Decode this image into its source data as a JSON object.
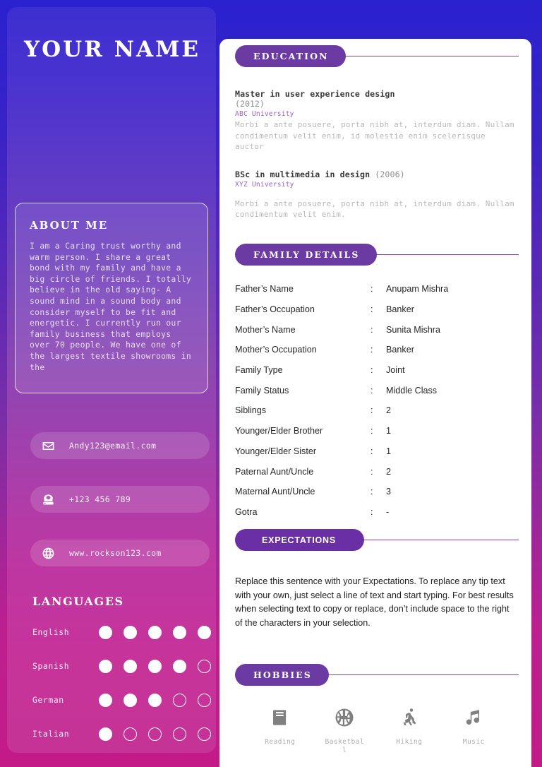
{
  "sidebar": {
    "name": "YOUR  NAME",
    "about": {
      "title": "ABOUT ME",
      "text": "I am a Caring trust worthy and warm person. I share a great bond with my family and have a big circle of friends. I totally believe in the old saying- A sound mind in a sound body and consider myself to be fit and energetic. I currently run our family business that employs over 70 people. We have one of the largest textile showrooms in the"
    },
    "contacts": [
      {
        "icon": "envelope-icon",
        "text": "Andy123@email.com"
      },
      {
        "icon": "telephone-icon",
        "text": "+123 456 789"
      },
      {
        "icon": "globe-icon",
        "text": "www.rockson123.com"
      }
    ],
    "languages": {
      "title": "LANGUAGES",
      "max": 5,
      "items": [
        {
          "name": "English",
          "level": 5
        },
        {
          "name": "Spanish",
          "level": 4
        },
        {
          "name": "German",
          "level": 3
        },
        {
          "name": "Italian",
          "level": 1
        }
      ]
    }
  },
  "main": {
    "education": {
      "title": "EDUCATION",
      "entries": [
        {
          "degree": "Master in user experience design",
          "year": "(2012)",
          "year_inline": false,
          "school": "ABC University",
          "description": "Morbi a ante posuere, porta nibh at, interdum diam. Nullam condimentum velit enim, id molestie enim scelerisque auctor"
        },
        {
          "degree": "BSc in multimedia in design",
          "year": "(2006)",
          "year_inline": true,
          "school": "XYZ University",
          "description": "Morbi a ante posuere, porta nibh at, interdum diam. Nullam condimentum velit enim."
        }
      ]
    },
    "family": {
      "title": "FAMILY DETAILS",
      "separator": ":",
      "rows": [
        {
          "label": "Father’s Name",
          "value": "Anupam Mishra"
        },
        {
          "label": "Father’s Occupation",
          "value": "Banker"
        },
        {
          "label": "Mother’s Name",
          "value": "Sunita Mishra"
        },
        {
          "label": "Mother’s Occupation",
          "value": "Banker"
        },
        {
          "label": "Family Type",
          "value": "Joint"
        },
        {
          "label": "Family Status",
          "value": "Middle Class"
        },
        {
          "label": "Siblings",
          "value": "2"
        },
        {
          "label": "Younger/Elder Brother",
          "value": "1"
        },
        {
          "label": "Younger/Elder Sister",
          "value": "1"
        },
        {
          "label": "Paternal Aunt/Uncle",
          "value": "2"
        },
        {
          "label": "Maternal Aunt/Uncle",
          "value": "3"
        },
        {
          "label": "Gotra",
          "value": "-"
        }
      ]
    },
    "expectations": {
      "title": "EXPECTATIONS",
      "text": "Replace this sentence with your Expectations. To replace any tip text with your own, just select a line of text and start typing. For best results when selecting text to copy or replace, don’t include space to the right of the characters in your selection."
    },
    "hobbies": {
      "title": "HOBBIES",
      "items": [
        {
          "icon": "book-icon",
          "label": "Reading"
        },
        {
          "icon": "basketball-icon",
          "label": "Basketball"
        },
        {
          "icon": "hiking-icon",
          "label": "Hiking"
        },
        {
          "icon": "music-note-icon",
          "label": "Music"
        }
      ]
    }
  },
  "colors": {
    "page_gradient_top": "#2a21cf",
    "page_gradient_bottom": "#c41a88",
    "pill_purple": "#6b3ba3",
    "accent_line": "#8a3fb5",
    "school_purple": "#9a62c9",
    "panel_white": "#ffffff",
    "hobby_icon_gray": "#808080"
  }
}
